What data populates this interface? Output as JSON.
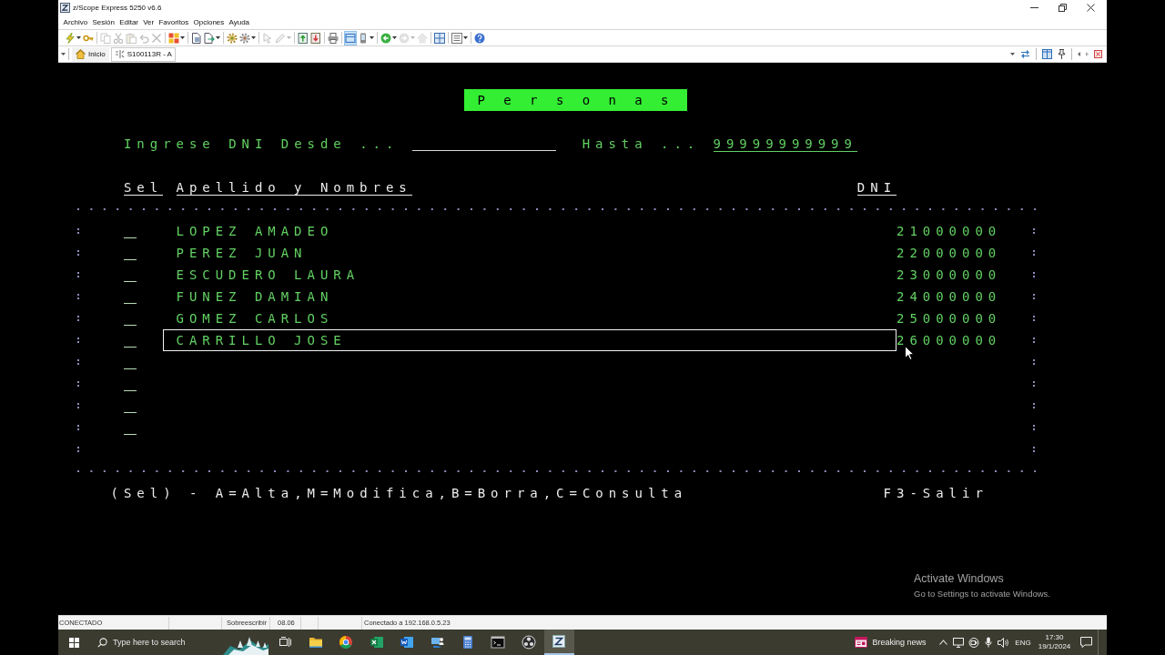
{
  "window": {
    "title": "z/Scope Express 5250 v6.6"
  },
  "menu": [
    "Archivo",
    "Sesión",
    "Editar",
    "Ver",
    "Favoritos",
    "Opciones",
    "Ayuda"
  ],
  "toolbar": {
    "groups": [
      {
        "buttons": [
          {
            "disabled": false,
            "on": false
          },
          {
            "disabled": false,
            "on": false
          }
        ]
      },
      {
        "buttons": [
          {
            "disabled": true,
            "on": false
          },
          {
            "disabled": true,
            "on": false
          },
          {
            "disabled": true,
            "on": false
          },
          {
            "disabled": true,
            "on": false
          },
          {
            "disabled": true,
            "on": false
          }
        ]
      },
      {
        "buttons": [
          {
            "disabled": false,
            "on": false
          }
        ]
      },
      {
        "buttons": [
          {
            "disabled": false,
            "on": false
          },
          {
            "disabled": false,
            "on": false
          }
        ]
      },
      {
        "buttons": [
          {
            "disabled": false,
            "on": false
          },
          {
            "disabled": false,
            "on": false
          }
        ]
      },
      {
        "buttons": [
          {
            "disabled": true,
            "on": false
          },
          {
            "disabled": true,
            "on": false
          }
        ]
      },
      {
        "buttons": [
          {
            "disabled": false,
            "on": false
          },
          {
            "disabled": false,
            "on": false
          }
        ]
      },
      {
        "buttons": [
          {
            "disabled": false,
            "on": false
          }
        ]
      },
      {
        "buttons": [
          {
            "disabled": false,
            "on": true
          },
          {
            "disabled": false,
            "on": false
          }
        ]
      },
      {
        "buttons": [
          {
            "disabled": false,
            "on": false
          },
          {
            "disabled": true,
            "on": false
          },
          {
            "disabled": true,
            "on": false
          }
        ]
      },
      {
        "buttons": [
          {
            "disabled": false,
            "on": false
          }
        ]
      },
      {
        "buttons": [
          {
            "disabled": false,
            "on": false
          }
        ]
      },
      {
        "buttons": [
          {
            "disabled": false,
            "on": false
          }
        ]
      }
    ]
  },
  "tabs": [
    {
      "label": "Inicio",
      "selected": false
    },
    {
      "label": "S100113R - A",
      "selected": true
    }
  ],
  "terminal": {
    "title": "P e r s o n a s",
    "filter": {
      "from_label": "Ingrese DNI Desde ...",
      "to_label": "Hasta ...",
      "to_value": "99999999999"
    },
    "columns": [
      "Sel",
      "Apellido y Nombres",
      "DNI"
    ],
    "rows": [
      {
        "name": "LOPEZ AMADEO",
        "dni": "21000000",
        "selected": false
      },
      {
        "name": "PEREZ JUAN",
        "dni": "22000000",
        "selected": false
      },
      {
        "name": "ESCUDERO LAURA",
        "dni": "23000000",
        "selected": false
      },
      {
        "name": "FUNEZ DAMIAN",
        "dni": "24000000",
        "selected": false
      },
      {
        "name": "GOMEZ CARLOS",
        "dni": "25000000",
        "selected": false
      },
      {
        "name": "CARRILLO JOSE",
        "dni": "26000000",
        "selected": true
      },
      {
        "selected": false
      },
      {
        "selected": false
      },
      {
        "selected": false
      },
      {
        "selected": false
      }
    ],
    "help": "(Sel) - A=Alta,M=Modifica,B=Borra,C=Consulta",
    "exit_key": "F3-Salir"
  },
  "activation_notice": {
    "title": "Activate Windows",
    "text": "Go to Settings to activate Windows."
  },
  "status_bar": [
    "CONECTADO",
    "Sobreescribir",
    "08.06",
    "Conectado a 192.168.0.5.23"
  ],
  "taskbar": {
    "search": {
      "placeholder": "Type here to search"
    },
    "apps": [
      {
        "active": false
      },
      {
        "active": false
      },
      {
        "active": false
      },
      {
        "active": false
      },
      {
        "active": false
      },
      {
        "active": false
      },
      {
        "active": false
      },
      {
        "active": false
      },
      {
        "active": true
      }
    ],
    "news": "Breaking news",
    "language": "ENG",
    "time": "17:30",
    "date": "19/1/2024"
  }
}
